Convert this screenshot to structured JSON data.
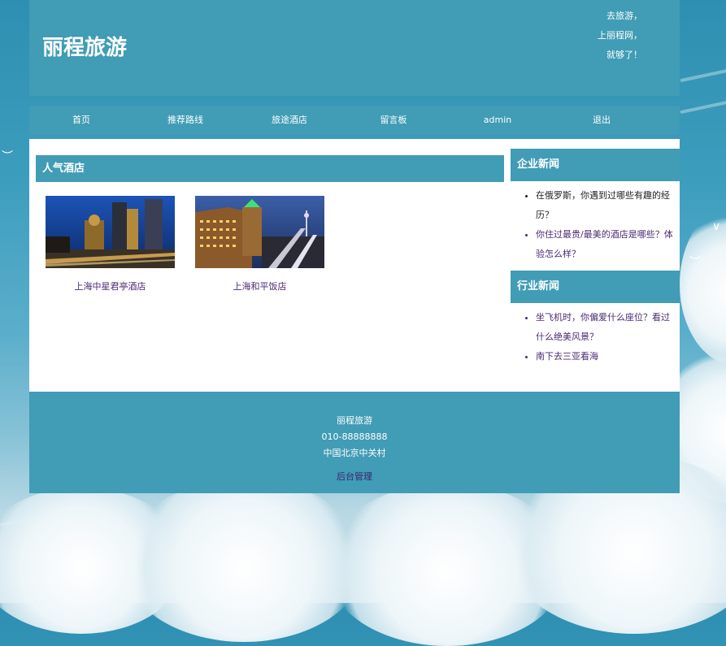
{
  "header": {
    "logo": "丽程旅游",
    "slogan": [
      "去旅游，",
      "上丽程网，",
      "就够了！"
    ]
  },
  "nav": {
    "items": [
      {
        "label": "首页"
      },
      {
        "label": "推荐路线"
      },
      {
        "label": "旅途酒店"
      },
      {
        "label": "留言板"
      },
      {
        "label": "admin"
      },
      {
        "label": "退出"
      }
    ]
  },
  "hot_hotels": {
    "title": "人气酒店",
    "items": [
      {
        "name": "上海中星君亭酒店"
      },
      {
        "name": "上海和平饭店"
      }
    ]
  },
  "company_news": {
    "title": "企业新闻",
    "items": [
      {
        "text": "在俄罗斯，你遇到过哪些有趣的经历？"
      },
      {
        "text": "你住过最贵/最美的酒店是哪些？体验怎么样？"
      }
    ]
  },
  "industry_news": {
    "title": "行业新闻",
    "items": [
      {
        "text": "坐飞机时，你偏爱什么座位？看过什么绝美风景？"
      },
      {
        "text": "南下去三亚看海"
      }
    ]
  },
  "footer": {
    "name": "丽程旅游",
    "phone": "010-88888888",
    "address": "中国北京中关村",
    "admin_link": "后台管理"
  },
  "colors": {
    "primary": "#419cb5",
    "link": "#4b2a73",
    "white": "#ffffff"
  }
}
